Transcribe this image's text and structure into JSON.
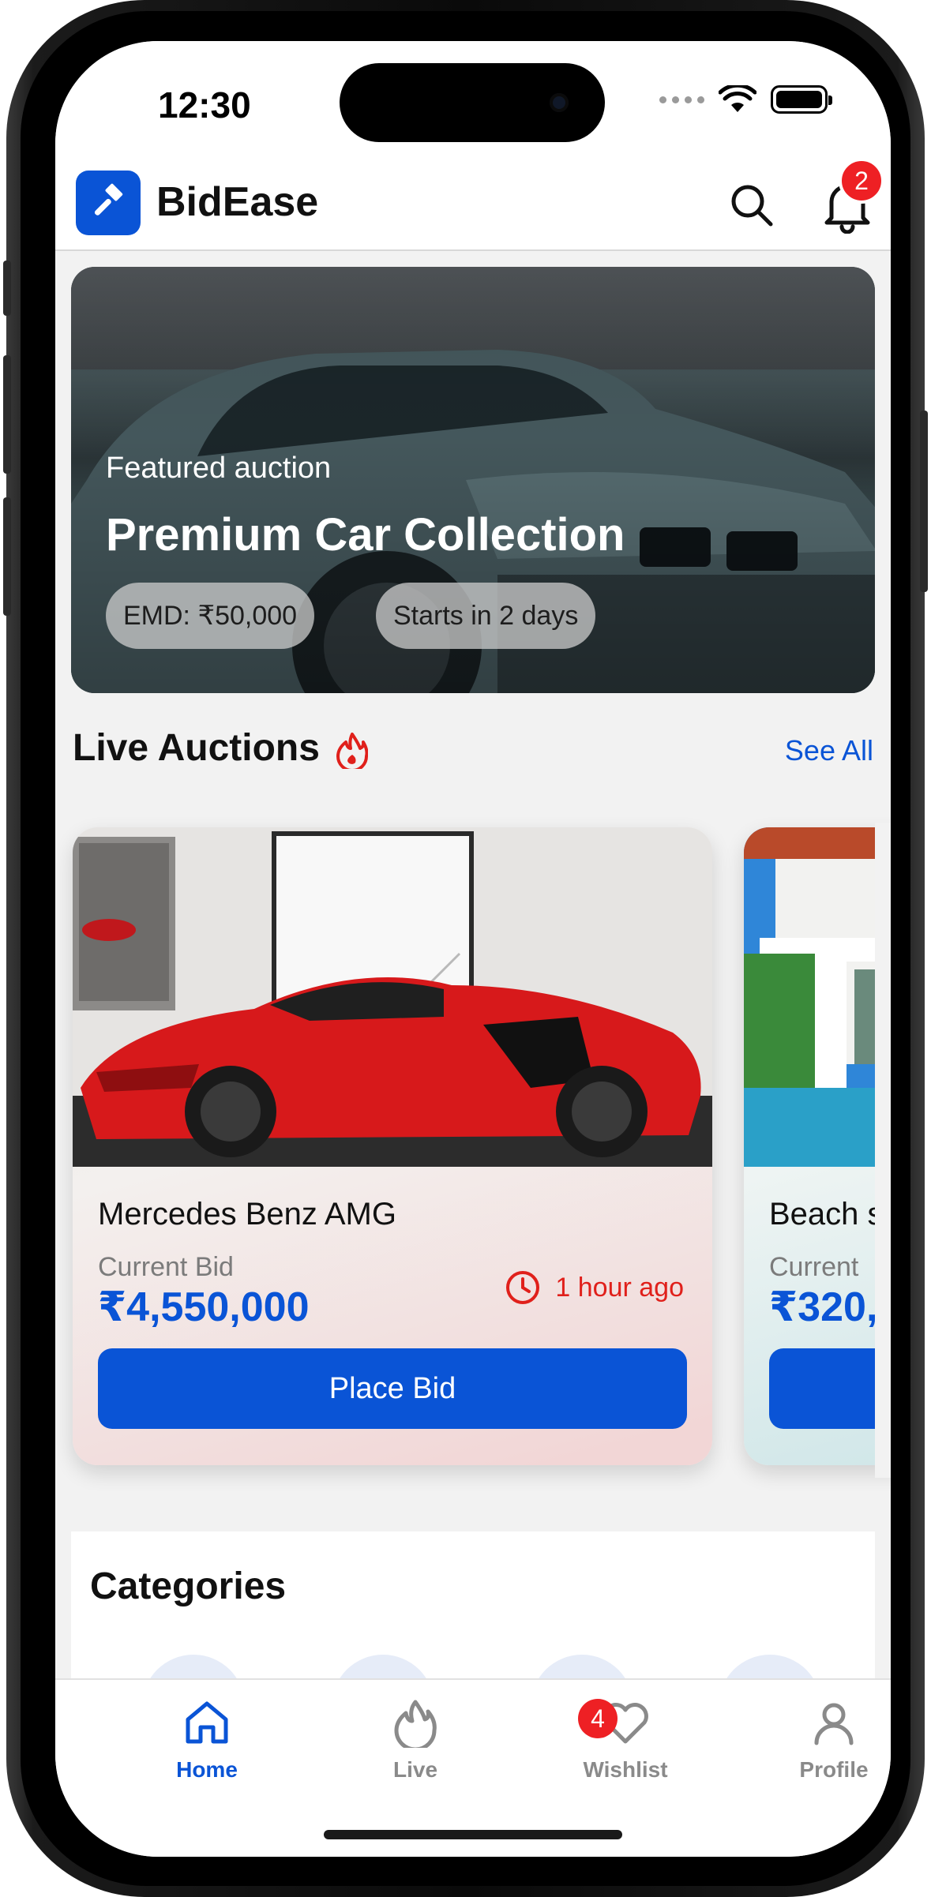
{
  "status_bar": {
    "time": "12:30"
  },
  "header": {
    "app_name": "BidEase",
    "notification_count": "2"
  },
  "featured": {
    "kicker": "Featured auction",
    "title": "Premium Car Collection",
    "emd": "EMD: ₹50,000",
    "starts": "Starts in 2 days"
  },
  "live_auctions": {
    "title": "Live Auctions",
    "see_all": "See All",
    "items": [
      {
        "name": "Mercedes Benz AMG",
        "bid_label": "Current Bid",
        "bid": "₹4,550,000",
        "time": "1 hour ago",
        "button": "Place Bid"
      },
      {
        "name": "Beach s",
        "bid_label": "Current",
        "bid": "₹320,",
        "button": ""
      }
    ]
  },
  "categories": {
    "title": "Categories"
  },
  "tabbar": {
    "items": [
      {
        "label": "Home",
        "icon": "home-icon",
        "active": true
      },
      {
        "label": "Live",
        "icon": "flame-icon"
      },
      {
        "label": "Wishlist",
        "icon": "heart-icon",
        "badge": "4"
      },
      {
        "label": "Profile",
        "icon": "user-icon"
      }
    ]
  },
  "colors": {
    "accent": "#0a54d6",
    "alert": "#ee2024",
    "time_red": "#e0201b"
  }
}
